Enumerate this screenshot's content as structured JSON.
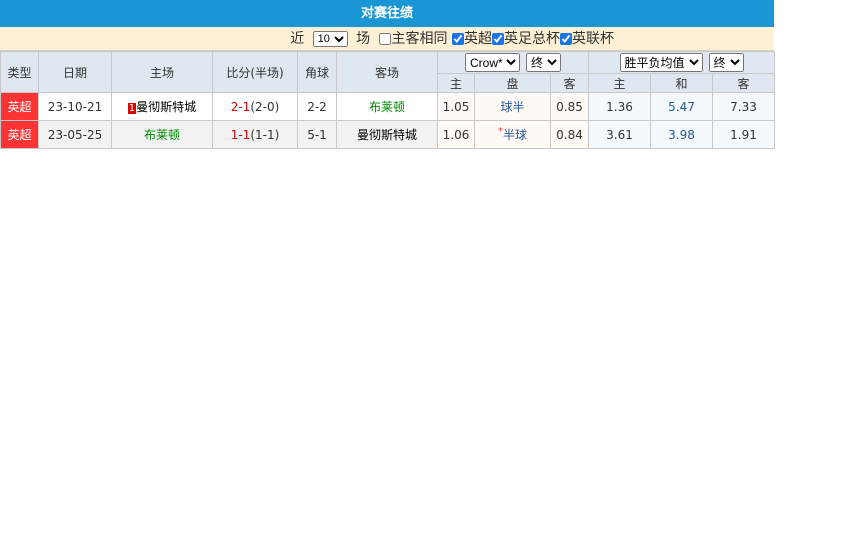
{
  "title": "对赛往绩",
  "filter": {
    "prefix": "近",
    "count": "10",
    "suffix": "场",
    "same_label": "主客相同",
    "leagues": [
      "英超",
      "英足总杯",
      "英联杯"
    ]
  },
  "headers": {
    "type": "类型",
    "date": "日期",
    "home": "主场",
    "score": "比分(半场)",
    "corner": "角球",
    "away": "客场",
    "ah_company": "Crow*",
    "ah_mode": "终",
    "eu_company": "胜平负均值",
    "eu_mode": "终",
    "sub": [
      "主",
      "盘",
      "客",
      "主",
      "和",
      "客"
    ]
  },
  "rows": [
    {
      "type": "英超",
      "date": "23-10-21",
      "home_rank": "1",
      "home": "曼彻斯特城",
      "score": "2-1",
      "half": "(2-0)",
      "corner": "2-2",
      "away": "布莱顿",
      "ah_home": "1.05",
      "ah_line": "球半",
      "ah_star": "",
      "ah_away": "0.85",
      "eu_home": "1.36",
      "eu_draw": "5.47",
      "eu_away": "7.33"
    },
    {
      "type": "英超",
      "date": "23-05-25",
      "home_rank": "",
      "home": "布莱顿",
      "score": "1-1",
      "half": "(1-1)",
      "corner": "5-1",
      "away": "曼彻斯特城",
      "ah_home": "1.06",
      "ah_line": "半球",
      "ah_star": "*",
      "ah_away": "0.84",
      "eu_home": "3.61",
      "eu_draw": "3.98",
      "eu_away": "1.91"
    }
  ]
}
